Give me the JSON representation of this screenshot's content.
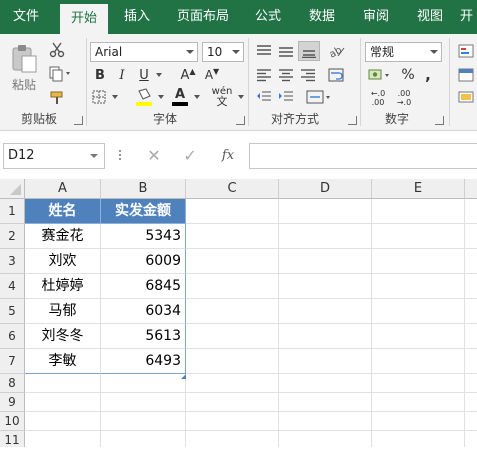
{
  "ribbon_tabs": [
    "文件",
    "开始",
    "插入",
    "页面布局",
    "公式",
    "数据",
    "审阅",
    "视图",
    "开"
  ],
  "active_tab": "开始",
  "clipboard": {
    "paste_label": "粘贴",
    "group_label": "剪贴板"
  },
  "font": {
    "name": "Arial",
    "size": "10",
    "bold": "B",
    "italic": "I",
    "underline": "U",
    "font_size_up": "A",
    "font_size_down": "A",
    "phonetic": "wén",
    "group_label": "字体"
  },
  "alignment": {
    "group_label": "对齐方式"
  },
  "number": {
    "format": "常规",
    "percent": "%",
    "comma": ",",
    "increase_decimal": "←.0\n.00",
    "decrease_decimal": ".00\n→.0",
    "group_label": "数字"
  },
  "formula_bar": {
    "name_box": "D12",
    "fx_label": "fx",
    "value": ""
  },
  "columns": [
    "A",
    "B",
    "C",
    "D",
    "E"
  ],
  "rows": [
    "1",
    "2",
    "3",
    "4",
    "5",
    "6",
    "7",
    "8",
    "9",
    "10",
    "11"
  ],
  "table": {
    "headers": [
      "姓名",
      "实发金额"
    ],
    "rows": [
      [
        "赛金花",
        "5343"
      ],
      [
        "刘欢",
        "6009"
      ],
      [
        "杜婷婷",
        "6845"
      ],
      [
        "马郁",
        "6034"
      ],
      [
        "刘冬冬",
        "5613"
      ],
      [
        "李敏",
        "6493"
      ]
    ]
  },
  "colors": {
    "ribbon_green": "#217346",
    "table_header": "#4f81bd",
    "font_color_bar": "#000000",
    "highlight_bar": "#ffff00"
  }
}
